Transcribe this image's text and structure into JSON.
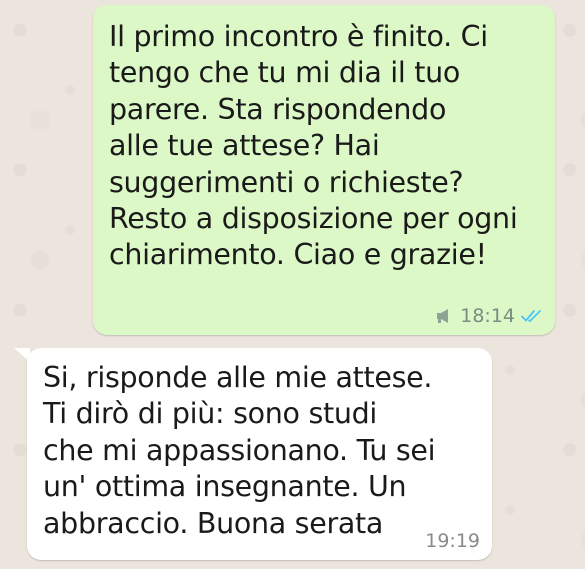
{
  "colors": {
    "background": "#ece5dd",
    "outgoing_bubble": "#dcf8c6",
    "incoming_bubble": "#ffffff",
    "read_ticks": "#4fc3f7"
  },
  "messages": [
    {
      "direction": "outgoing",
      "text": "Il primo incontro è finito. Ci\ntengo che tu mi dia il tuo\nparere. Sta rispondendo\nalle tue attese? Hai\nsuggerimenti o richieste?\nResto a disposizione per ogni\nchiarimento. Ciao e grazie!",
      "time": "18:14",
      "icons": [
        "broadcast-icon",
        "double-check-read-icon"
      ]
    },
    {
      "direction": "incoming",
      "text": "Si, risponde alle mie attese.\nTi dirò di più: sono studi\nche mi appassionano. Tu sei\nun' ottima insegnante. Un\nabbraccio. Buona serata",
      "time": "19:19"
    }
  ]
}
